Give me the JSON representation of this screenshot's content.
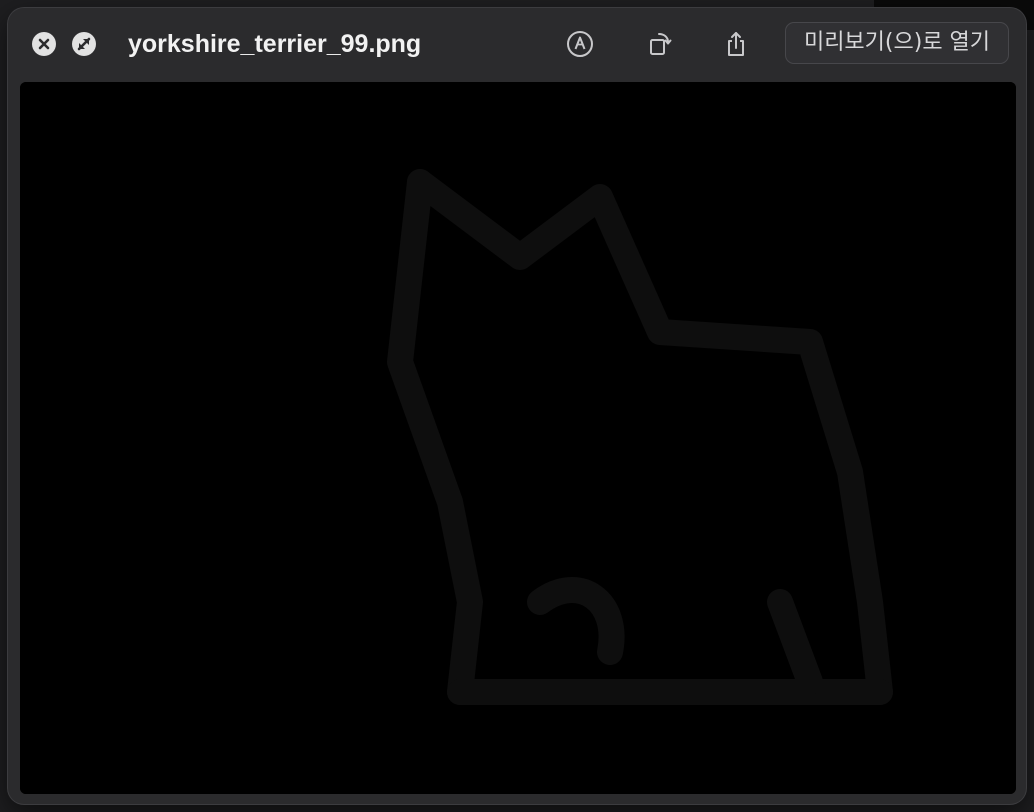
{
  "window": {
    "title": "yorkshire_terrier_99.png"
  },
  "titlebar": {
    "close_icon": "close-icon",
    "fullscreen_icon": "fullscreen-icon",
    "markup_icon": "markup-pen-icon",
    "rotate_icon": "rotate-left-icon",
    "share_icon": "share-icon",
    "open_with_preview_label": "미리보기(으)로 열기"
  },
  "preview": {
    "image_name": "yorkshire_terrier_99.png",
    "content": "very dark dog silhouette image"
  },
  "colors": {
    "window_bg": "#2b2b2d",
    "preview_bg": "#000000",
    "title_text": "#f2f2f2",
    "button_text": "#d8d8da"
  }
}
